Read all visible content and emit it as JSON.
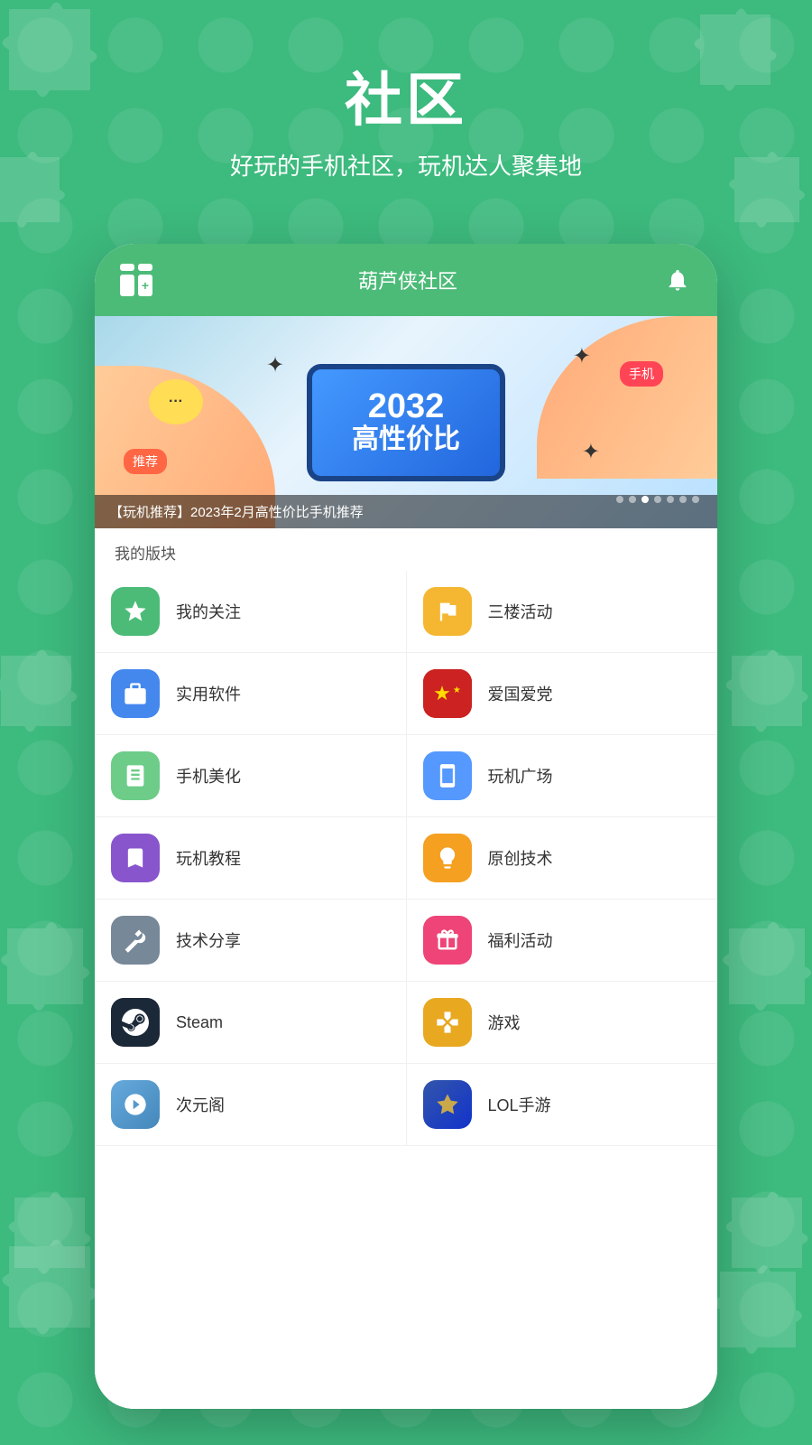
{
  "background_color": "#3dba7e",
  "title": "社区",
  "subtitle": "好玩的手机社区，玩机达人聚集地",
  "app_header": {
    "app_name": "葫芦侠社区"
  },
  "banner": {
    "caption": "【玩机推荐】2023年2月高性价比手机推荐",
    "big_text_line1": "2032",
    "big_text_line2": "高性价比",
    "recommend_badge": "推荐",
    "mobile_badge": "手机",
    "dots": [
      false,
      false,
      true,
      false,
      false,
      false,
      false
    ]
  },
  "section_label": "我的版块",
  "menu_items": [
    {
      "left": {
        "icon": "star",
        "color": "green",
        "text": "我的关注"
      },
      "right": {
        "icon": "flag",
        "color": "yellow",
        "text": "三楼活动"
      }
    },
    {
      "left": {
        "icon": "box",
        "color": "blue",
        "text": "实用软件"
      },
      "right": {
        "icon": "china-flag",
        "color": "red",
        "text": "爱国爱党"
      }
    },
    {
      "left": {
        "icon": "book",
        "color": "light-green",
        "text": "手机美化"
      },
      "right": {
        "icon": "phone",
        "color": "blue2",
        "text": "玩机广场"
      }
    },
    {
      "left": {
        "icon": "bookmark",
        "color": "purple",
        "text": "玩机教程"
      },
      "right": {
        "icon": "bulb",
        "color": "orange",
        "text": "原创技术"
      }
    },
    {
      "left": {
        "icon": "wrench",
        "color": "gray",
        "text": "技术分享"
      },
      "right": {
        "icon": "gift",
        "color": "pink",
        "text": "福利活动"
      }
    },
    {
      "left": {
        "icon": "steam",
        "color": "dark",
        "text": "Steam"
      },
      "right": {
        "icon": "game",
        "color": "gold",
        "text": "游戏"
      }
    },
    {
      "left": {
        "icon": "anime",
        "color": "anime",
        "text": "次元阁"
      },
      "right": {
        "icon": "lol",
        "color": "blue",
        "text": "LOL手游"
      }
    }
  ]
}
